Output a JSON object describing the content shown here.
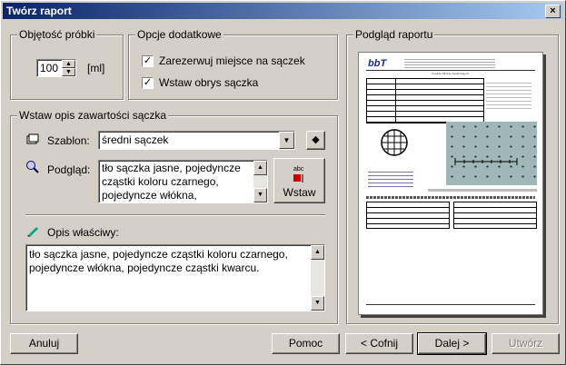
{
  "window": {
    "title": "Twórz raport",
    "close": "×"
  },
  "sample": {
    "group": "Objętość próbki",
    "value": "100",
    "unit": "[ml]"
  },
  "options": {
    "group": "Opcje dodatkowe",
    "reserve": "Zarezerwuj miejsce na sączek",
    "outline": "Wstaw obrys sączka",
    "reserve_checked": "✓",
    "outline_checked": "✓"
  },
  "insert": {
    "group": "Wstaw opis zawartości sączka",
    "template_label": "Szablon:",
    "template_value": "średni sączek",
    "preview_label": "Podgląd:",
    "preview_text": "tło sączka jasne, pojedyncze cząstki koloru czarnego, pojedyncze włókna, pojedyncze",
    "insert_btn": "Wstaw",
    "insert_icon_text": "abc",
    "custom_label": "Opis właściwy:",
    "custom_text": "tło sączka jasne, pojedyncze cząstki koloru czarnego, pojedyncze włókna, pojedyncze cząstki kwarcu."
  },
  "preview": {
    "group": "Podgląd raportu",
    "logo": "bbT",
    "doc_title": "Analiza filtrów rejestrowych"
  },
  "buttons": {
    "cancel": "Anuluj",
    "help": "Pomoc",
    "back": "< Cofnij",
    "next": "Dalej >",
    "create": "Utwórz"
  }
}
